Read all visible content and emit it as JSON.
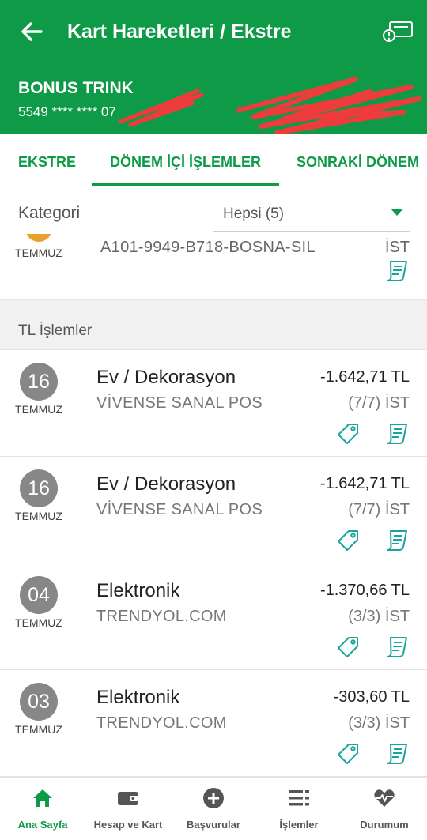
{
  "header": {
    "title": "Kart Hareketleri / Ekstre",
    "back_icon": "arrow-left-icon",
    "card_icon": "card-info-icon",
    "color": "#0f9a48"
  },
  "card": {
    "name": "BONUS TRINK",
    "number": "5549 **** **** 07"
  },
  "tabs": [
    {
      "label": "EKSTRE",
      "active": false
    },
    {
      "label": "DÖNEM İÇİ İŞLEMLER",
      "active": true
    },
    {
      "label": "SONRAKİ DÖNEM",
      "active": false
    }
  ],
  "filter": {
    "label": "Kategori",
    "value": "Hepsi (5)"
  },
  "partial_row": {
    "month": "TEMMUZ",
    "merchant": "A101-9949-B718-BOSNA-SIL",
    "city": "İST"
  },
  "section_label": "TL İşlemler",
  "transactions": [
    {
      "day": "16",
      "month": "TEMMUZ",
      "category": "Ev / Dekorasyon",
      "merchant": "VİVENSE SANAL POS",
      "amount": "-1.642,71 TL",
      "installment": "(7/7) İST"
    },
    {
      "day": "16",
      "month": "TEMMUZ",
      "category": "Ev / Dekorasyon",
      "merchant": "VİVENSE SANAL POS",
      "amount": "-1.642,71 TL",
      "installment": "(7/7) İST"
    },
    {
      "day": "04",
      "month": "TEMMUZ",
      "category": "Elektronik",
      "merchant": "TRENDYOL.COM",
      "amount": "-1.370,66 TL",
      "installment": "(3/3) İST"
    },
    {
      "day": "03",
      "month": "TEMMUZ",
      "category": "Elektronik",
      "merchant": "TRENDYOL.COM",
      "amount": "-303,60 TL",
      "installment": "(3/3) İST"
    }
  ],
  "bottom_nav": [
    {
      "label": "Ana Sayfa",
      "icon": "home-icon",
      "active": true
    },
    {
      "label": "Hesap ve Kart",
      "icon": "wallet-icon",
      "active": false
    },
    {
      "label": "Başvurular",
      "icon": "plus-circle-icon",
      "active": false
    },
    {
      "label": "İşlemler",
      "icon": "list-icon",
      "active": false
    },
    {
      "label": "Durumum",
      "icon": "heart-pulse-icon",
      "active": false
    }
  ]
}
